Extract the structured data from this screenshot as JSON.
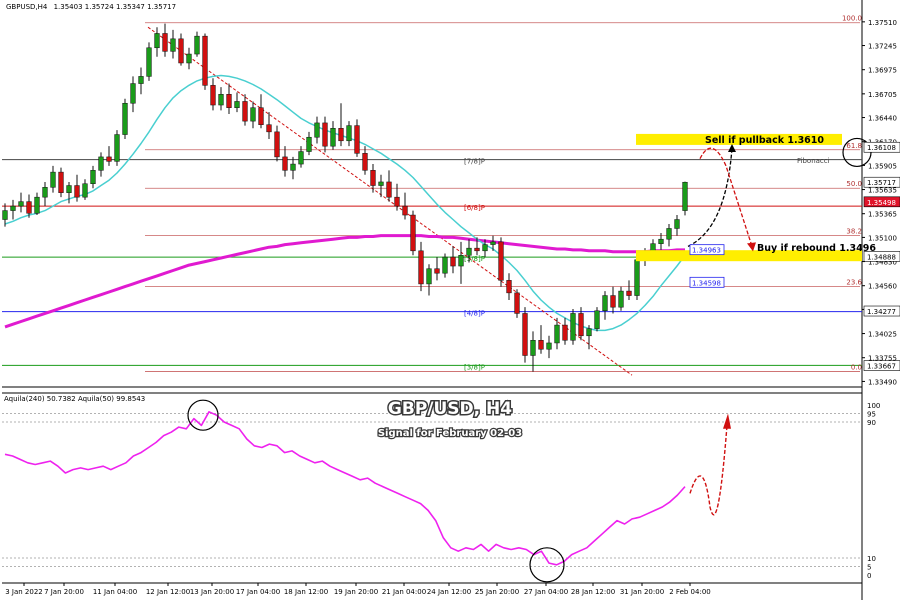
{
  "chart_data": {
    "type": "candlestick",
    "header": {
      "symbol_label": "GBPUSD,H4",
      "ohlc": "1.35403 1.35724 1.35347 1.35717"
    },
    "overlay": {
      "title": "GBP/USD, H4",
      "subtitle": "Signal for February 02-03"
    },
    "ylim": [
      1.3345,
      1.3762
    ],
    "y_ticks": [
      "1.37510",
      "1.37245",
      "1.36975",
      "1.36705",
      "1.36440",
      "1.36170",
      "1.35905",
      "1.35635",
      "1.35365",
      "1.35100",
      "1.34830",
      "1.34560",
      "1.34295",
      "1.34025",
      "1.33755",
      "1.33490"
    ],
    "x_labels": [
      "3 Jan 2022",
      "7 Jan 20:00",
      "11 Jan 04:00",
      "12 Jan 12:00",
      "13 Jan 20:00",
      "17 Jan 04:00",
      "18 Jan 12:00",
      "19 Jan 20:00",
      "21 Jan 04:00",
      "24 Jan 12:00",
      "25 Jan 20:00",
      "27 Jan 04:00",
      "28 Jan 12:00",
      "31 Jan 20:00",
      "2 Feb 04:00"
    ],
    "candles": [
      [
        1.353,
        1.3548,
        1.3522,
        1.354
      ],
      [
        1.354,
        1.3552,
        1.353,
        1.3545
      ],
      [
        1.3545,
        1.356,
        1.3538,
        1.355
      ],
      [
        1.355,
        1.3558,
        1.3532,
        1.3537
      ],
      [
        1.3537,
        1.356,
        1.3535,
        1.3555
      ],
      [
        1.3555,
        1.3572,
        1.3545,
        1.3566
      ],
      [
        1.3566,
        1.359,
        1.356,
        1.3583
      ],
      [
        1.3583,
        1.3588,
        1.3555,
        1.356
      ],
      [
        1.356,
        1.3572,
        1.3548,
        1.3568
      ],
      [
        1.3568,
        1.358,
        1.355,
        1.3555
      ],
      [
        1.3555,
        1.3575,
        1.3552,
        1.357
      ],
      [
        1.357,
        1.359,
        1.3565,
        1.3585
      ],
      [
        1.3585,
        1.3605,
        1.3578,
        1.36
      ],
      [
        1.36,
        1.3612,
        1.359,
        1.3595
      ],
      [
        1.3595,
        1.363,
        1.359,
        1.3625
      ],
      [
        1.3625,
        1.3665,
        1.362,
        1.366
      ],
      [
        1.366,
        1.369,
        1.365,
        1.3682
      ],
      [
        1.3682,
        1.37,
        1.367,
        1.369
      ],
      [
        1.369,
        1.3728,
        1.3685,
        1.3722
      ],
      [
        1.3722,
        1.3745,
        1.3712,
        1.3738
      ],
      [
        1.3738,
        1.3749,
        1.3712,
        1.3718
      ],
      [
        1.3718,
        1.3742,
        1.371,
        1.3732
      ],
      [
        1.3732,
        1.3738,
        1.3702,
        1.3705
      ],
      [
        1.3705,
        1.3722,
        1.3698,
        1.3715
      ],
      [
        1.3715,
        1.374,
        1.3712,
        1.3735
      ],
      [
        1.3735,
        1.3738,
        1.3675,
        1.368
      ],
      [
        1.368,
        1.3688,
        1.3652,
        1.3658
      ],
      [
        1.3658,
        1.3678,
        1.3652,
        1.367
      ],
      [
        1.367,
        1.3682,
        1.3648,
        1.3655
      ],
      [
        1.3655,
        1.3672,
        1.365,
        1.3662
      ],
      [
        1.3662,
        1.367,
        1.3635,
        1.364
      ],
      [
        1.364,
        1.3662,
        1.3632,
        1.3655
      ],
      [
        1.3655,
        1.367,
        1.3632,
        1.3636
      ],
      [
        1.3636,
        1.365,
        1.362,
        1.3628
      ],
      [
        1.3628,
        1.3635,
        1.3595,
        1.36
      ],
      [
        1.36,
        1.3612,
        1.3578,
        1.3585
      ],
      [
        1.3585,
        1.36,
        1.3575,
        1.3592
      ],
      [
        1.3592,
        1.3612,
        1.3588,
        1.3606
      ],
      [
        1.3606,
        1.3628,
        1.3602,
        1.3622
      ],
      [
        1.3622,
        1.3645,
        1.3615,
        1.3638
      ],
      [
        1.3638,
        1.3645,
        1.3605,
        1.3612
      ],
      [
        1.3612,
        1.364,
        1.3608,
        1.3632
      ],
      [
        1.3632,
        1.366,
        1.3612,
        1.3618
      ],
      [
        1.3618,
        1.364,
        1.3612,
        1.3635
      ],
      [
        1.3635,
        1.3642,
        1.36,
        1.3604
      ],
      [
        1.3604,
        1.3612,
        1.358,
        1.3585
      ],
      [
        1.3585,
        1.3592,
        1.356,
        1.3568
      ],
      [
        1.3568,
        1.358,
        1.3555,
        1.3572
      ],
      [
        1.3572,
        1.3585,
        1.355,
        1.3555
      ],
      [
        1.3555,
        1.357,
        1.354,
        1.3545
      ],
      [
        1.3545,
        1.356,
        1.353,
        1.3535
      ],
      [
        1.3535,
        1.354,
        1.349,
        1.3495
      ],
      [
        1.3495,
        1.3505,
        1.345,
        1.3458
      ],
      [
        1.3458,
        1.348,
        1.3445,
        1.3475
      ],
      [
        1.3475,
        1.3488,
        1.3462,
        1.347
      ],
      [
        1.347,
        1.3492,
        1.3465,
        1.3488
      ],
      [
        1.3488,
        1.35,
        1.347,
        1.3478
      ],
      [
        1.3478,
        1.3505,
        1.3458,
        1.349
      ],
      [
        1.349,
        1.3508,
        1.3482,
        1.3498
      ],
      [
        1.3498,
        1.351,
        1.349,
        1.3495
      ],
      [
        1.3495,
        1.3508,
        1.3488,
        1.3502
      ],
      [
        1.3502,
        1.3512,
        1.3495,
        1.3505
      ],
      [
        1.3505,
        1.351,
        1.3455,
        1.3462
      ],
      [
        1.3462,
        1.347,
        1.344,
        1.3448
      ],
      [
        1.3448,
        1.3452,
        1.342,
        1.3425
      ],
      [
        1.3425,
        1.3432,
        1.337,
        1.3378
      ],
      [
        1.3378,
        1.3405,
        1.336,
        1.3395
      ],
      [
        1.3395,
        1.3412,
        1.338,
        1.3385
      ],
      [
        1.3385,
        1.34,
        1.3375,
        1.3392
      ],
      [
        1.3392,
        1.342,
        1.3385,
        1.3412
      ],
      [
        1.3412,
        1.342,
        1.339,
        1.3395
      ],
      [
        1.3395,
        1.343,
        1.339,
        1.3425
      ],
      [
        1.3425,
        1.3432,
        1.3395,
        1.34
      ],
      [
        1.34,
        1.3412,
        1.3385,
        1.3408
      ],
      [
        1.3408,
        1.3432,
        1.3405,
        1.3428
      ],
      [
        1.3428,
        1.345,
        1.3418,
        1.3445
      ],
      [
        1.3445,
        1.3455,
        1.3425,
        1.3432
      ],
      [
        1.3432,
        1.3455,
        1.3428,
        1.345
      ],
      [
        1.345,
        1.3462,
        1.344,
        1.3445
      ],
      [
        1.3445,
        1.349,
        1.344,
        1.3485
      ],
      [
        1.3485,
        1.3498,
        1.3478,
        1.3495
      ],
      [
        1.3495,
        1.3508,
        1.3488,
        1.3503
      ],
      [
        1.3503,
        1.3515,
        1.3496,
        1.3508
      ],
      [
        1.3508,
        1.3525,
        1.35,
        1.352
      ],
      [
        1.352,
        1.3535,
        1.3512,
        1.353
      ],
      [
        1.354,
        1.35724,
        1.35347,
        1.35717
      ]
    ],
    "ma_fast": [
      1.3525,
      1.3528,
      1.3532,
      1.3535,
      1.3537,
      1.354,
      1.3545,
      1.355,
      1.3553,
      1.3556,
      1.3558,
      1.3562,
      1.3568,
      1.3574,
      1.3582,
      1.3592,
      1.3603,
      1.3615,
      1.3628,
      1.3642,
      1.3655,
      1.3666,
      1.3674,
      1.368,
      1.3685,
      1.3688,
      1.369,
      1.3691,
      1.369,
      1.3688,
      1.3685,
      1.3681,
      1.3676,
      1.367,
      1.3664,
      1.3657,
      1.365,
      1.3643,
      1.3638,
      1.3634,
      1.363,
      1.3627,
      1.3624,
      1.3621,
      1.3618,
      1.3614,
      1.3609,
      1.3604,
      1.3598,
      1.3592,
      1.3585,
      1.3577,
      1.3567,
      1.3557,
      1.3547,
      1.3538,
      1.353,
      1.3522,
      1.3515,
      1.3508,
      1.3502,
      1.3497,
      1.349,
      1.3482,
      1.3473,
      1.3462,
      1.345,
      1.344,
      1.3432,
      1.3425,
      1.342,
      1.3415,
      1.3411,
      1.3408,
      1.3406,
      1.3406,
      1.3408,
      1.3412,
      1.3418,
      1.3425,
      1.3434,
      1.3444,
      1.3456,
      1.3467,
      1.3478,
      1.349
    ],
    "ma_slow": [
      1.341,
      1.3413,
      1.3416,
      1.3419,
      1.3422,
      1.3425,
      1.3428,
      1.3431,
      1.3434,
      1.3437,
      1.344,
      1.3443,
      1.3446,
      1.3449,
      1.3452,
      1.3455,
      1.3458,
      1.3461,
      1.3464,
      1.3467,
      1.347,
      1.3473,
      1.3476,
      1.3479,
      1.3481,
      1.3483,
      1.3485,
      1.3487,
      1.3489,
      1.3491,
      1.3493,
      1.3495,
      1.3497,
      1.3499,
      1.35,
      1.3502,
      1.3503,
      1.3504,
      1.3505,
      1.3506,
      1.3507,
      1.3508,
      1.3509,
      1.351,
      1.351,
      1.3511,
      1.3511,
      1.3512,
      1.3512,
      1.3512,
      1.3512,
      1.3512,
      1.3512,
      1.3511,
      1.3511,
      1.351,
      1.351,
      1.3509,
      1.3508,
      1.3507,
      1.3506,
      1.3505,
      1.3504,
      1.3503,
      1.3502,
      1.3501,
      1.35,
      1.3499,
      1.3498,
      1.3497,
      1.3497,
      1.3496,
      1.3496,
      1.3495,
      1.3495,
      1.3495,
      1.3494,
      1.3494,
      1.3494,
      1.3494,
      1.3494,
      1.3495,
      1.3495,
      1.3495,
      1.3496,
      1.3496
    ],
    "levels": [
      {
        "label": "[7/8]P",
        "value": 1.3597,
        "kind": "murrey"
      },
      {
        "label": "[6/8]P",
        "value": 1.3545,
        "kind": "murrey"
      },
      {
        "label": "[5/8]P",
        "value": 1.3488,
        "kind": "murrey"
      },
      {
        "label": "[4/8]P",
        "value": 1.3427,
        "kind": "murrey"
      },
      {
        "label": "[3/8]P",
        "value": 1.3367,
        "kind": "murrey"
      },
      {
        "label": "100.0",
        "value": 1.375,
        "kind": "fib"
      },
      {
        "label": "61.8",
        "value": 1.3608,
        "kind": "fib"
      },
      {
        "label": "50.0",
        "value": 1.3565,
        "kind": "fib"
      },
      {
        "label": "38.2",
        "value": 1.3512,
        "kind": "fib"
      },
      {
        "label": "23.6",
        "value": 1.3455,
        "kind": "fib"
      },
      {
        "label": "0.0",
        "value": 1.336,
        "kind": "fib"
      }
    ],
    "fib_label": "Fibonacci",
    "price_tags": [
      {
        "text": "1.36108",
        "value": 1.36108,
        "bg": "#ffffff",
        "fg": "#000000"
      },
      {
        "text": "1.35717",
        "value": 1.35717,
        "bg": "#ffffff",
        "fg": "#000000"
      },
      {
        "text": "1.35498",
        "value": 1.35498,
        "bg": "#e0142a",
        "fg": "#ffffff"
      },
      {
        "text": "1.34888",
        "value": 1.34888,
        "bg": "#ffffff",
        "fg": "#000000"
      },
      {
        "text": "1.34277",
        "value": 1.34277,
        "bg": "#ffffff",
        "fg": "#000000"
      },
      {
        "text": "1.33667",
        "value": 1.33667,
        "bg": "#ffffff",
        "fg": "#000000"
      }
    ],
    "inline_tags": [
      {
        "text": "1.34963",
        "value": 1.34963
      },
      {
        "text": "1.34598",
        "value": 1.34598
      }
    ],
    "annotations": {
      "sell": "Sell if pullback 1.3610",
      "buy": "Buy if rebound 1.3496"
    },
    "indicator": {
      "label": "Aquila(240) 50.7382  Aquila(50) 99.8543",
      "ylim": [
        0,
        100
      ],
      "ticks": [
        "100",
        "95",
        "90",
        "10",
        "5",
        "0"
      ],
      "values": [
        71,
        70,
        68,
        66,
        65,
        66,
        67,
        64,
        60,
        62,
        63,
        62,
        63,
        64,
        62,
        64,
        66,
        70,
        72,
        75,
        78,
        82,
        84,
        87,
        86,
        92,
        88,
        96,
        94,
        90,
        88,
        86,
        80,
        76,
        75,
        77,
        76,
        72,
        73,
        70,
        68,
        66,
        67,
        64,
        62,
        60,
        58,
        56,
        57,
        54,
        52,
        50,
        48,
        46,
        44,
        42,
        38,
        32,
        22,
        16,
        14,
        16,
        15,
        18,
        14,
        18,
        16,
        15,
        16,
        15,
        12,
        14,
        7,
        6,
        8,
        12,
        14,
        16,
        20,
        24,
        28,
        32,
        30,
        33,
        34,
        36,
        38,
        40,
        43,
        47,
        52
      ]
    },
    "colors": {
      "bull": "#1a9b1a",
      "bear": "#d01010",
      "ma_fast": "#49cfd0",
      "ma_slow": "#e01ad0",
      "indicator": "#ee22ee",
      "highlight": "#ffee00",
      "projection": "#d01010"
    }
  }
}
